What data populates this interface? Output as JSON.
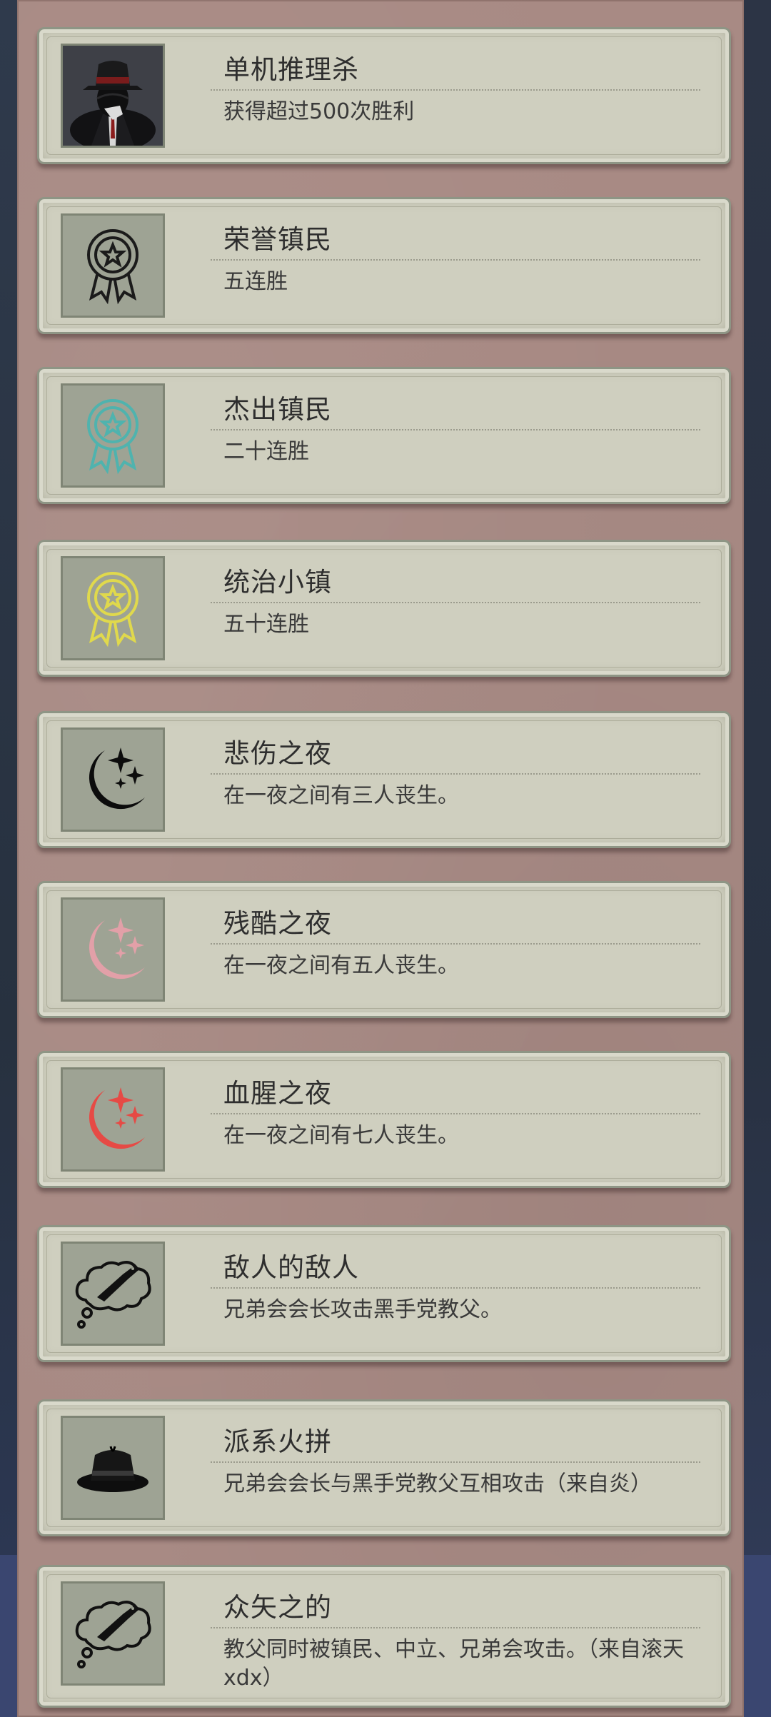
{
  "achievements": [
    {
      "title": "单机推理杀",
      "desc": "获得超过500次胜利",
      "icon": "detective-hat-icon"
    },
    {
      "title": "荣誉镇民",
      "desc": "五连胜",
      "icon": "medal-icon",
      "icon_color": "#1b1b1b"
    },
    {
      "title": "杰出镇民",
      "desc": "二十连胜",
      "icon": "medal-icon",
      "icon_color": "#4fb3ae"
    },
    {
      "title": "统治小镇",
      "desc": "五十连胜",
      "icon": "medal-icon",
      "icon_color": "#e0d94c"
    },
    {
      "title": "悲伤之夜",
      "desc": "在一夜之间有三人丧生。",
      "icon": "moon-stars-icon",
      "icon_color": "#0c0c0c"
    },
    {
      "title": "残酷之夜",
      "desc": "在一夜之间有五人丧生。",
      "icon": "moon-stars-icon",
      "icon_color": "#e2a0a8"
    },
    {
      "title": "血腥之夜",
      "desc": "在一夜之间有七人丧生。",
      "icon": "moon-stars-icon",
      "icon_color": "#e64a45"
    },
    {
      "title": "敌人的敌人",
      "desc": "兄弟会会长攻击黑手党教父。",
      "icon": "thought-knife-icon"
    },
    {
      "title": "派系火拼",
      "desc": "兄弟会会长与黑手党教父互相攻击（来自炎）",
      "icon": "fedora-icon"
    },
    {
      "title": "众矢之的",
      "desc": "教父同时被镇民、中立、兄弟会攻击。（来自滚天xdx）",
      "icon": "thought-knife-icon"
    }
  ]
}
